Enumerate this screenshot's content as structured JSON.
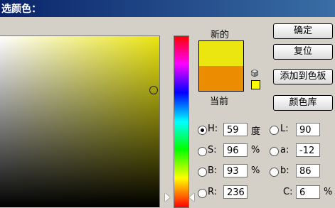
{
  "window": {
    "title": "选颜色："
  },
  "swatches": {
    "new_label": "新的",
    "current_label": "当前",
    "new_color": "#ebe510",
    "current_color": "#ec8c00",
    "web_safe_color": "#ffff00"
  },
  "buttons": {
    "ok": "确定",
    "reset": "复位",
    "add_to_swatches": "添加到色板",
    "color_libraries": "颜色库"
  },
  "hsb": {
    "h": {
      "label": "H:",
      "value": "59",
      "unit": "度",
      "selected": true
    },
    "s": {
      "label": "S:",
      "value": "96",
      "unit": "%"
    },
    "b": {
      "label": "B:",
      "value": "93",
      "unit": "%"
    }
  },
  "lab": {
    "l": {
      "label": "L:",
      "value": "90"
    },
    "a": {
      "label": "a:",
      "value": "-12"
    },
    "b": {
      "label": "b:",
      "value": "86"
    }
  },
  "rgb": {
    "r": {
      "label": "R:",
      "value": "236"
    }
  },
  "cmyk": {
    "c": {
      "label": "C:",
      "value": "6",
      "unit": "%"
    }
  },
  "colors": {
    "picker_hue": "#ebe510"
  }
}
